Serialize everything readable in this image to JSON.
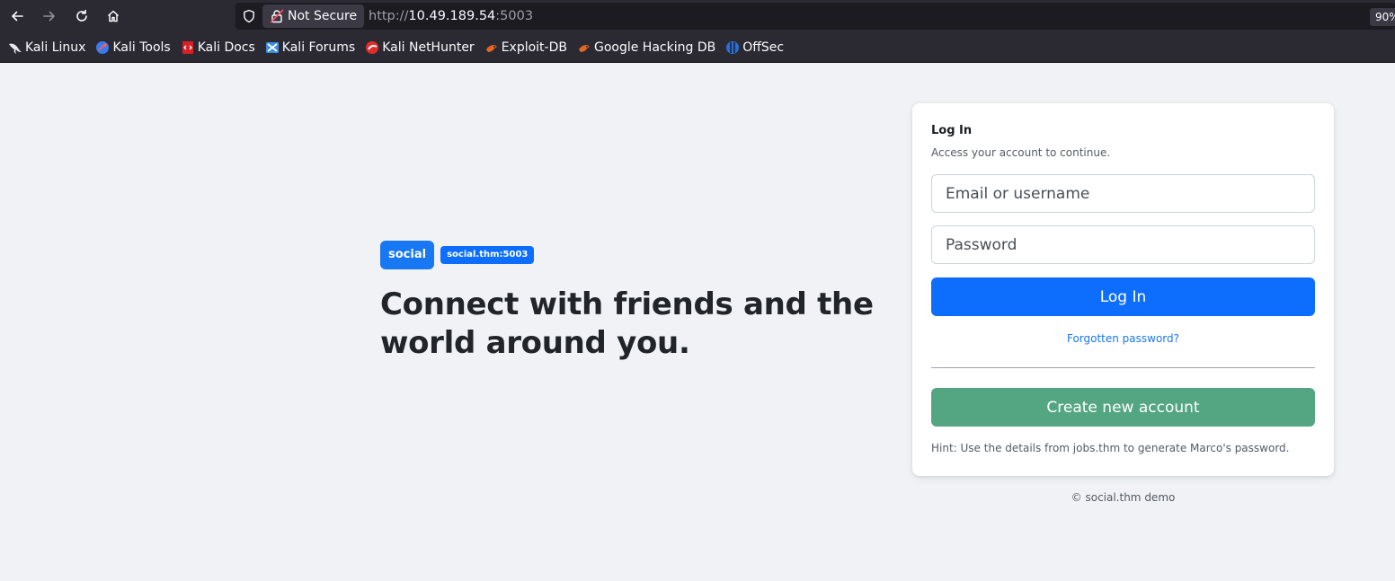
{
  "browser": {
    "security_label": "Not Secure",
    "url_scheme": "http://",
    "url_host": "10.49.189.54",
    "url_port": ":5003",
    "zoom": "90%",
    "bookmarks": [
      {
        "label": "Kali Linux",
        "icon": "kali-dragon-icon"
      },
      {
        "label": "Kali Tools",
        "icon": "kali-tools-icon"
      },
      {
        "label": "Kali Docs",
        "icon": "kali-docs-icon"
      },
      {
        "label": "Kali Forums",
        "icon": "kali-forums-icon"
      },
      {
        "label": "Kali NetHunter",
        "icon": "kali-nethunter-icon"
      },
      {
        "label": "Exploit-DB",
        "icon": "exploit-db-icon"
      },
      {
        "label": "Google Hacking DB",
        "icon": "google-hacking-db-icon"
      },
      {
        "label": "OffSec",
        "icon": "offsec-icon"
      }
    ]
  },
  "hero": {
    "brand": "social",
    "host_badge": "social.thm:5003",
    "tagline": "Connect with friends and the world around you."
  },
  "login": {
    "title": "Log In",
    "subtitle": "Access your account to continue.",
    "email_placeholder": "Email or username",
    "password_placeholder": "Password",
    "login_button": "Log In",
    "forgot_link": "Forgotten password?",
    "create_button": "Create new account",
    "hint": "Hint: Use the details from jobs.thm to generate Marco's password."
  },
  "footer": {
    "text": "© social.thm demo"
  },
  "colors": {
    "brand_blue": "#1877f2",
    "primary": "#0d6efd",
    "success": "#54a683",
    "page_bg": "#f0f2f5"
  }
}
